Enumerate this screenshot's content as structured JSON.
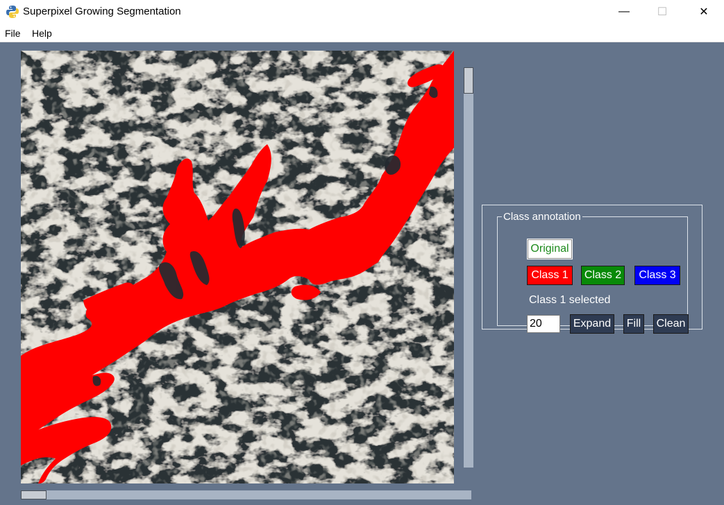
{
  "window": {
    "title": "Superpixel Growing Segmentation",
    "minimize_glyph": "—",
    "maximize_glyph": "☐",
    "close_glyph": "✕"
  },
  "menu": {
    "file": "File",
    "help": "Help"
  },
  "panel": {
    "legend": "Class annotation",
    "original_label": "Original",
    "class1_label": "Class 1",
    "class2_label": "Class 2",
    "class3_label": "Class 3",
    "status": "Class 1 selected",
    "size_value": "20",
    "expand_label": "Expand",
    "fill_label": "Fill",
    "clean_label": "Clean"
  },
  "colors": {
    "background": "#64748b",
    "class1": "#ff0000",
    "class2": "#098a09",
    "class3": "#0000f5",
    "tool_button": "#2e3b52"
  },
  "icons": [
    "python-app-icon",
    "minimize-icon",
    "maximize-icon",
    "close-icon"
  ]
}
